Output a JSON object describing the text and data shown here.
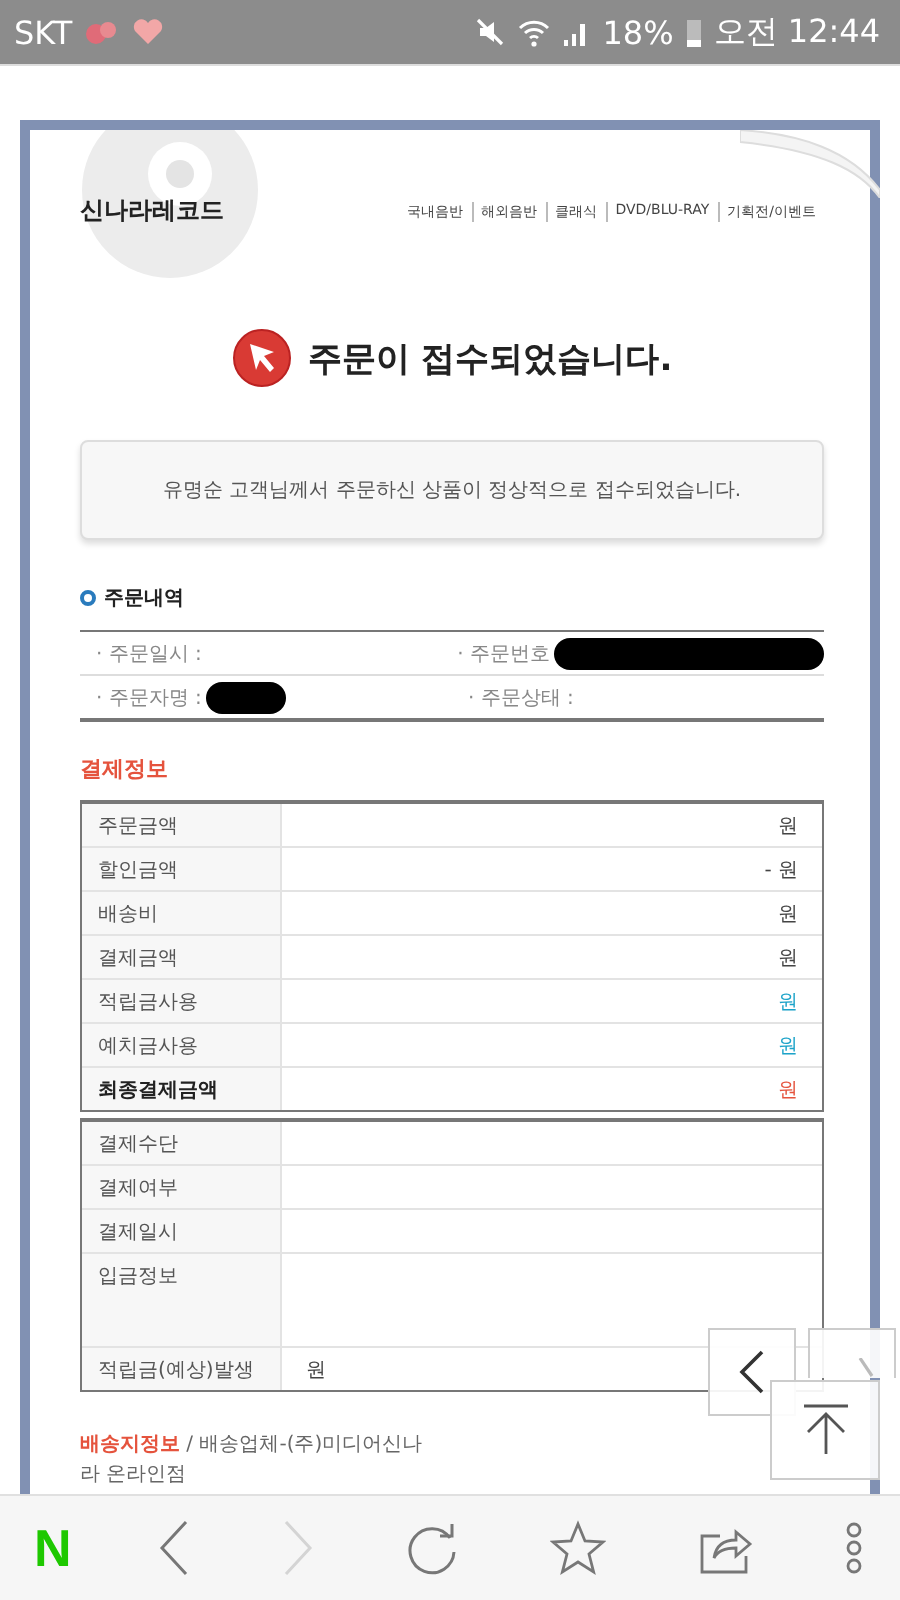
{
  "status_bar": {
    "carrier": "SKT",
    "battery": "18%",
    "time": "오전 12:44"
  },
  "site": {
    "logo": "신나라레코드",
    "nav": [
      "국내음반",
      "해외음반",
      "클래식",
      "DVD/BLU-RAY",
      "기획전/이벤트"
    ]
  },
  "title": "주문이 접수되었습니다.",
  "notice": "유명순 고객님께서 주문하신 상품이 정상적으로 접수되었습니다.",
  "order": {
    "heading": "주문내역",
    "fields": [
      {
        "label": "· 주문일시 :",
        "redacted": false
      },
      {
        "label": "· 주문번호",
        "redacted": true
      },
      {
        "label": "· 주문자명 :",
        "redacted": true
      },
      {
        "label": "· 주문상태 :",
        "redacted": false
      }
    ]
  },
  "payment": {
    "heading": "결제정보",
    "rows": [
      {
        "label": "주문금액",
        "amount": "원",
        "bold": false
      },
      {
        "label": "할인금액",
        "amount": "- 원",
        "bold": false
      },
      {
        "label": "배송비",
        "amount": "원",
        "bold": false
      },
      {
        "label": "결제금액",
        "amount": "원",
        "bold": false
      },
      {
        "label": "적립금사용",
        "amount": "원",
        "bold": false,
        "color": "#1ca3c9"
      },
      {
        "label": "예치금사용",
        "amount": "원",
        "bold": false,
        "color": "#1ca3c9"
      },
      {
        "label": "최종결제금액",
        "amount": "원",
        "bold": true,
        "color": "#e5533d"
      }
    ]
  },
  "method": {
    "rows": [
      {
        "label": "결제수단",
        "kind": "short"
      },
      {
        "label": "결제여부",
        "kind": "short"
      },
      {
        "label": "결제일시",
        "kind": "short"
      },
      {
        "label": "입금정보",
        "kind": "tall"
      },
      {
        "label": "적립금(예상)발생",
        "kind": "short",
        "value": "원"
      }
    ]
  },
  "shipping": {
    "heading": "배송지정보",
    "detail": " / 배송업체-(주)미디어신나라 온라인점"
  },
  "browser_bar": {
    "logo": "N",
    "buttons": [
      {
        "kind": "back",
        "disabled": false
      },
      {
        "kind": "forward",
        "disabled": true
      },
      {
        "kind": "reload",
        "disabled": false
      },
      {
        "kind": "bookmark",
        "disabled": false
      },
      {
        "kind": "share",
        "disabled": false
      },
      {
        "kind": "more",
        "disabled": false
      }
    ]
  }
}
